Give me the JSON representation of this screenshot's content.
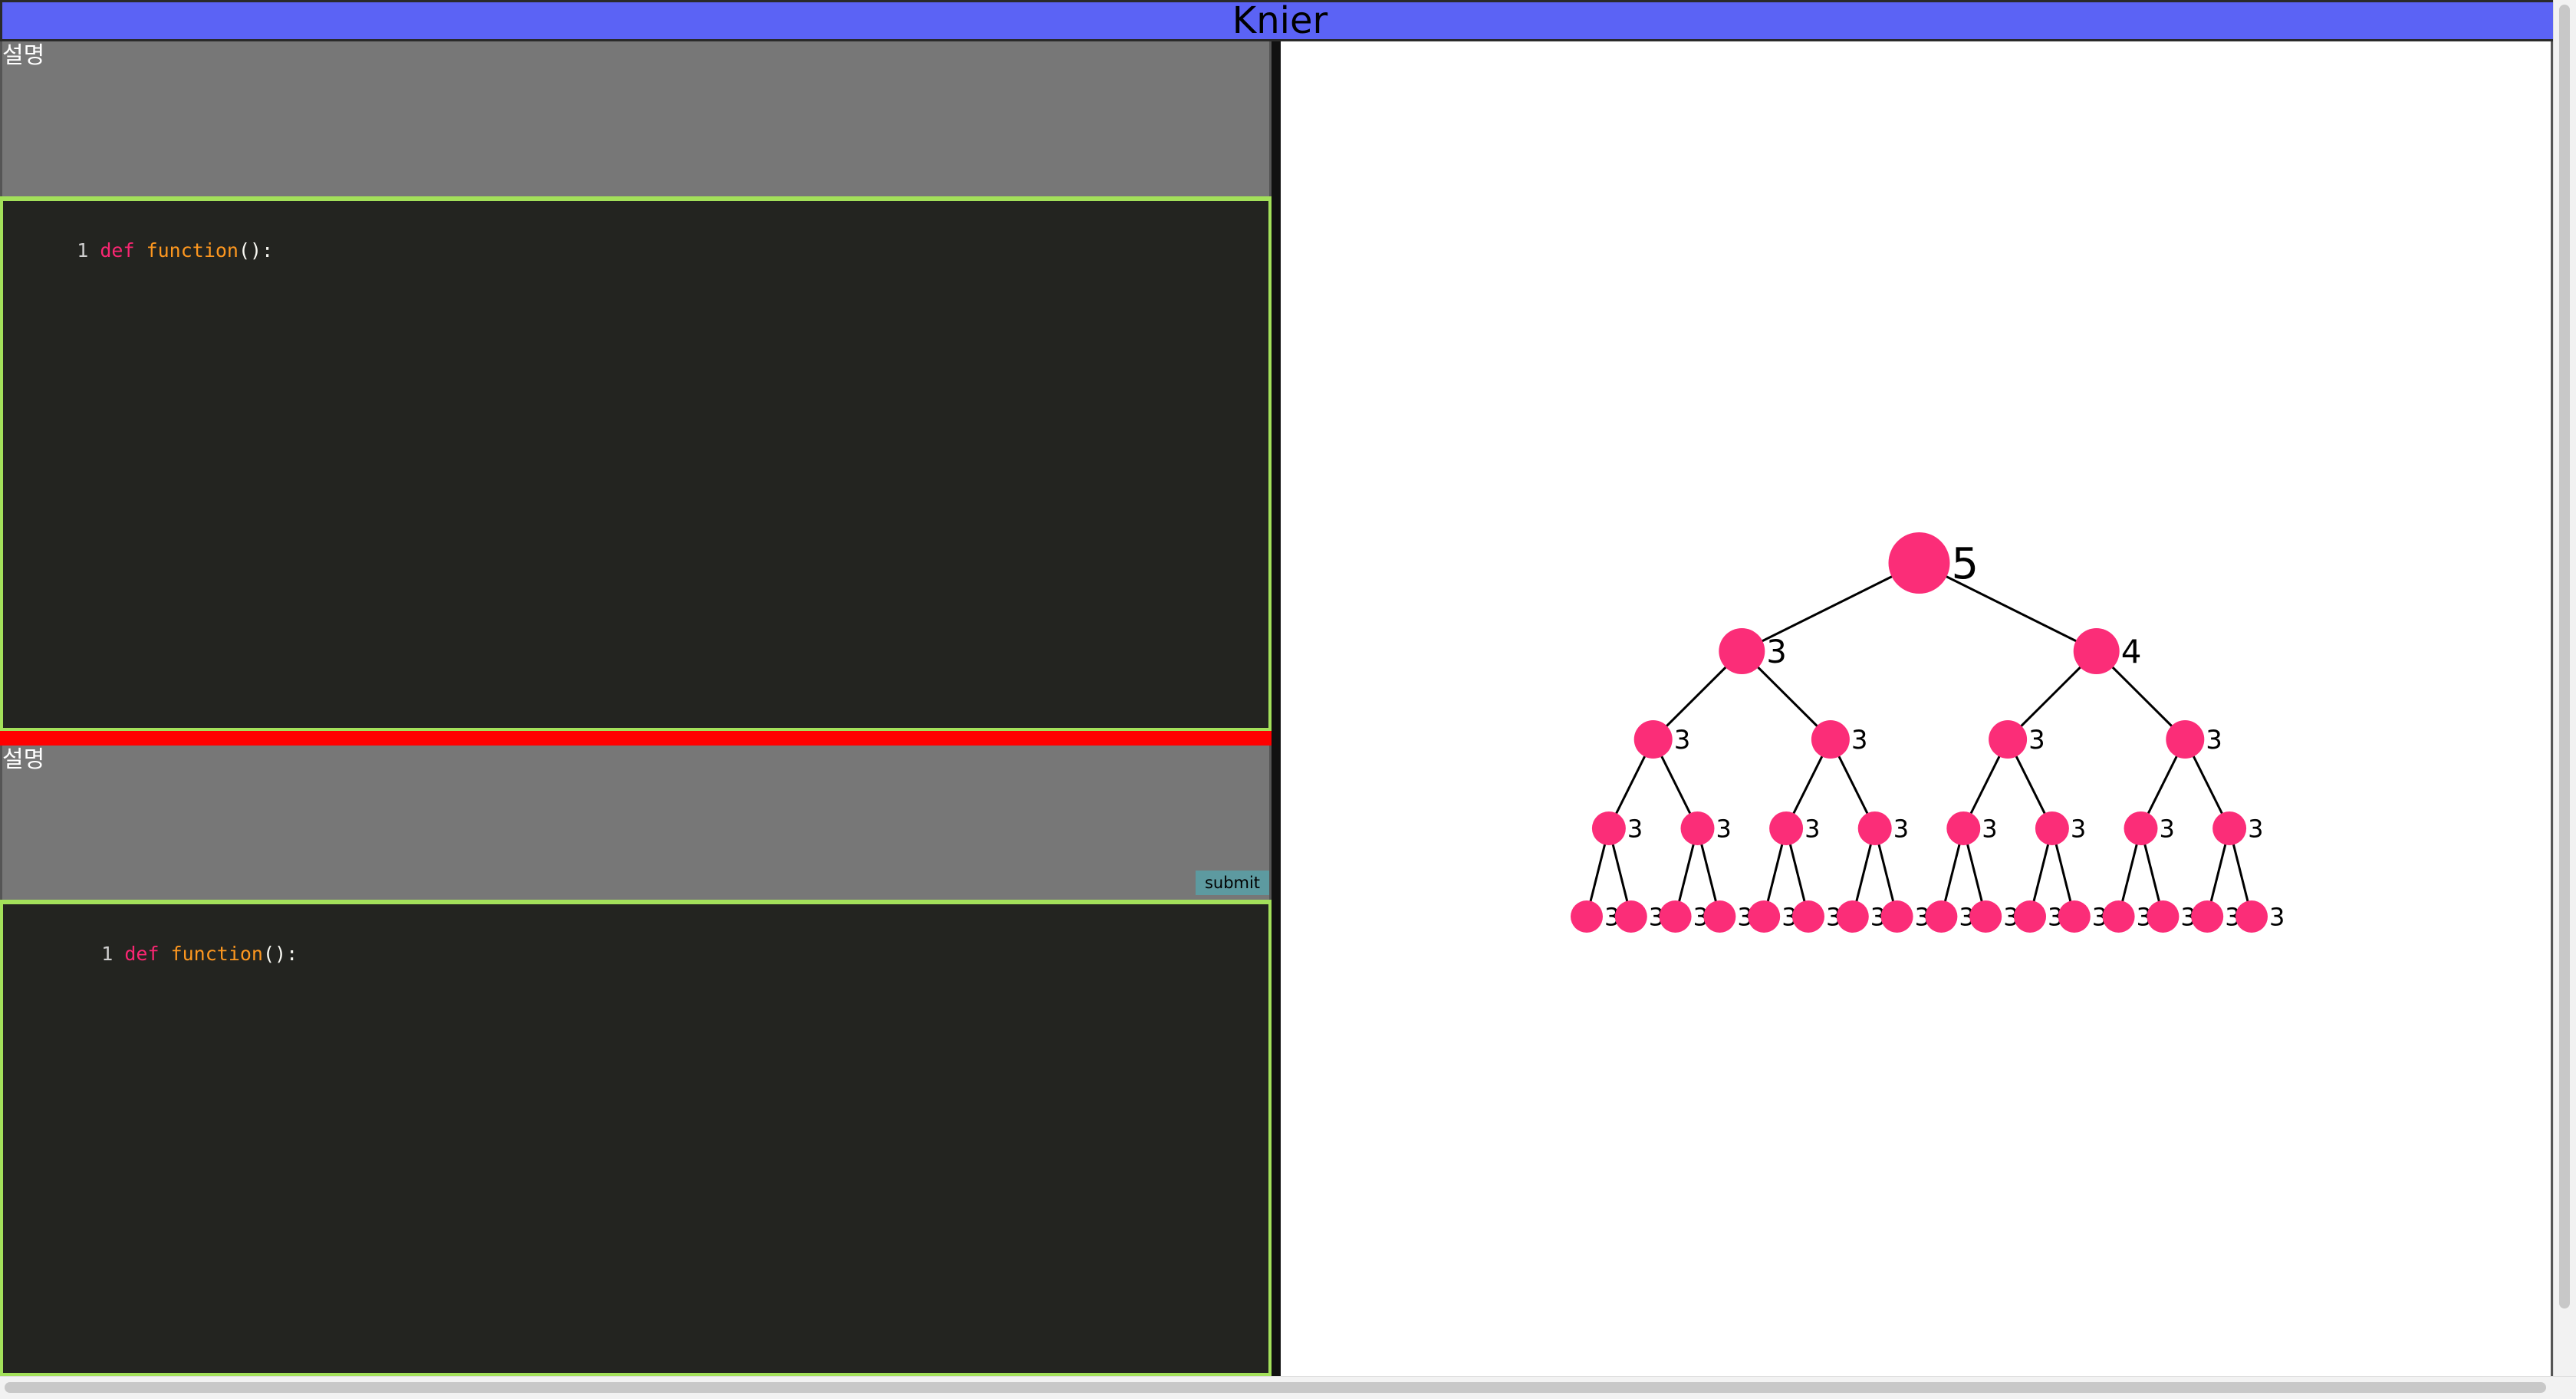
{
  "app": {
    "title": "Knier"
  },
  "top_description": {
    "label": "설명"
  },
  "top_editor": {
    "line_number": "1",
    "keyword": "def",
    "function_name": "function",
    "tail": "():"
  },
  "bottom_description": {
    "label": "설명",
    "submit_label": "submit"
  },
  "bottom_editor": {
    "line_number": "1",
    "keyword": "def",
    "function_name": "function",
    "tail": "():"
  },
  "tree": {
    "node_color": "#fb2d78",
    "edge_color": "#000000",
    "root_value": "5",
    "level1": [
      "3",
      "4"
    ],
    "level2": [
      "3",
      "3",
      "3",
      "3"
    ],
    "level3": [
      "3",
      "3",
      "3",
      "3",
      "3",
      "3",
      "3",
      "3"
    ],
    "level4": [
      "3",
      "3",
      "3",
      "3",
      "3",
      "3",
      "3",
      "3",
      "3",
      "3",
      "3",
      "3",
      "3",
      "3",
      "3",
      "3"
    ]
  }
}
